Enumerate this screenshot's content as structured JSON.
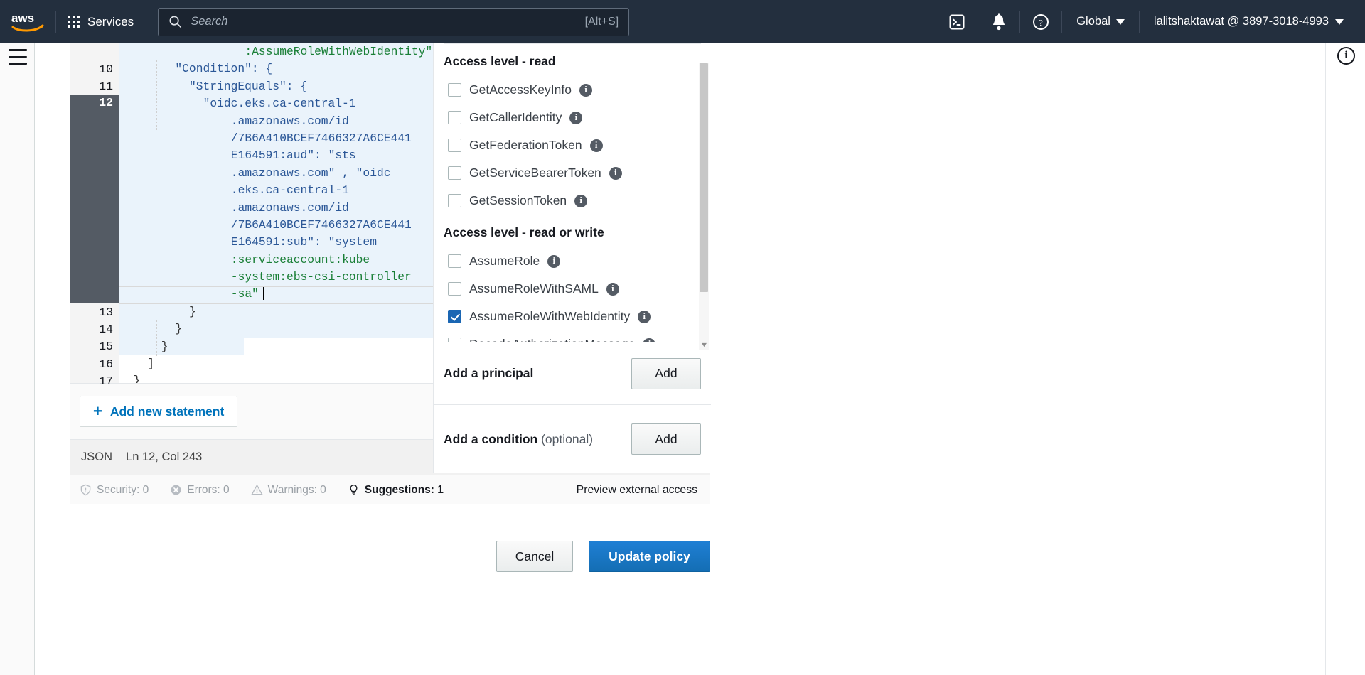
{
  "nav": {
    "logo_alt": "aws",
    "services_label": "Services",
    "search_placeholder": "Search",
    "search_shortcut": "[Alt+S]",
    "cloudshell_icon": "cloudshell-icon",
    "notifications_icon": "bell-icon",
    "help_icon": "help-icon",
    "region_label": "Global",
    "account_label": "lalitshaktawat @ 3897-3018-4993"
  },
  "editor": {
    "language": "JSON",
    "position": "Ln 12, Col 243",
    "add_statement_label": "Add new statement",
    "add_statement_icon": "plus-icon",
    "lines": [
      {
        "num": "",
        "indent": 0,
        "text": ":AssumeRoleWithWebIdentity\",",
        "pad": 18,
        "kind": "str",
        "highlight": true
      },
      {
        "num": "10",
        "fold": true,
        "indent": 0,
        "text": "\"Condition\": {",
        "pad": 8,
        "kind": "key",
        "highlight": true
      },
      {
        "num": "11",
        "fold": true,
        "indent": 0,
        "text": "\"StringEquals\": {",
        "pad": 10,
        "kind": "key",
        "highlight": true
      },
      {
        "num": "12",
        "fold": false,
        "indent": 0,
        "text": "\"oidc.eks.ca-central-1",
        "pad": 12,
        "kind": "key",
        "highlight": true,
        "active": true
      },
      {
        "num": "",
        "indent": 0,
        "text": ".amazonaws.com/id",
        "pad": 16,
        "kind": "key",
        "highlight": true
      },
      {
        "num": "",
        "indent": 0,
        "text": "/7B6A410BCEF7466327A6CE441",
        "pad": 16,
        "kind": "key",
        "highlight": true
      },
      {
        "num": "",
        "indent": 0,
        "text": "E164591:aud\": \"sts",
        "pad": 16,
        "kind": "mixed",
        "highlight": true
      },
      {
        "num": "",
        "indent": 0,
        "text": ".amazonaws.com\" , \"oidc",
        "pad": 16,
        "kind": "mixed",
        "highlight": true
      },
      {
        "num": "",
        "indent": 0,
        "text": ".eks.ca-central-1",
        "pad": 16,
        "kind": "key",
        "highlight": true
      },
      {
        "num": "",
        "indent": 0,
        "text": ".amazonaws.com/id",
        "pad": 16,
        "kind": "key",
        "highlight": true
      },
      {
        "num": "",
        "indent": 0,
        "text": "/7B6A410BCEF7466327A6CE441",
        "pad": 16,
        "kind": "key",
        "highlight": true
      },
      {
        "num": "",
        "indent": 0,
        "text": "E164591:sub\": \"system",
        "pad": 16,
        "kind": "mixed",
        "highlight": true
      },
      {
        "num": "",
        "indent": 0,
        "text": ":serviceaccount:kube",
        "pad": 16,
        "kind": "str",
        "highlight": true
      },
      {
        "num": "",
        "indent": 0,
        "text": "-system:ebs-csi-controller",
        "pad": 16,
        "kind": "str",
        "highlight": true
      },
      {
        "num": "",
        "indent": 0,
        "text": "-sa\"",
        "pad": 16,
        "kind": "str",
        "highlight": true,
        "cursor": true
      },
      {
        "num": "13",
        "indent": 0,
        "text": "}",
        "pad": 10,
        "kind": "punct",
        "highlight": true
      },
      {
        "num": "14",
        "indent": 0,
        "text": "}",
        "pad": 8,
        "kind": "punct",
        "highlight": true
      },
      {
        "num": "15",
        "indent": 0,
        "text": "}",
        "pad": 6,
        "kind": "punct",
        "highlight": "partial"
      },
      {
        "num": "16",
        "indent": 0,
        "text": "]",
        "pad": 4,
        "kind": "punct",
        "highlight": false
      },
      {
        "num": "17",
        "indent": 0,
        "text": "}",
        "pad": 2,
        "kind": "punct",
        "highlight": false
      }
    ]
  },
  "footer": {
    "security_label": "Security: 0",
    "security_icon": "shield-icon",
    "errors_label": "Errors: 0",
    "errors_icon": "error-circle-icon",
    "warnings_label": "Warnings: 0",
    "warnings_icon": "warning-triangle-icon",
    "suggestions_label": "Suggestions: 1",
    "suggestions_icon": "lightbulb-icon",
    "preview_label": "Preview external access"
  },
  "permissions": {
    "sections": [
      {
        "heading": "Access level - read",
        "items": [
          {
            "label": "GetAccessKeyInfo",
            "checked": false,
            "info": "i"
          },
          {
            "label": "GetCallerIdentity",
            "checked": false,
            "info": "i"
          },
          {
            "label": "GetFederationToken",
            "checked": false,
            "info": "i"
          },
          {
            "label": "GetServiceBearerToken",
            "checked": false,
            "info": "i"
          },
          {
            "label": "GetSessionToken",
            "checked": false,
            "info": "i"
          }
        ]
      },
      {
        "heading": "Access level - read or write",
        "items": [
          {
            "label": "AssumeRole",
            "checked": false,
            "info": "i"
          },
          {
            "label": "AssumeRoleWithSAML",
            "checked": false,
            "info": "i"
          },
          {
            "label": "AssumeRoleWithWebIdentity",
            "checked": true,
            "info": "i"
          },
          {
            "label": "DecodeAuthorizationMessage",
            "checked": false,
            "info": "i"
          }
        ]
      }
    ],
    "add_principal": {
      "label": "Add a principal",
      "optional": "",
      "button": "Add"
    },
    "add_condition": {
      "label": "Add a condition",
      "optional": " (optional)",
      "button": "Add"
    }
  },
  "actions": {
    "cancel_label": "Cancel",
    "update_label": "Update policy"
  },
  "colors": {
    "nav_bg": "#232f3e",
    "link_blue": "#0073bb",
    "primary_blue": "#146eb4",
    "checkbox_blue": "#1a66b3",
    "code_key": "#2b5797",
    "code_string": "#1a7f37",
    "gutter_active": "#545b64",
    "highlight": "#eaf3fb"
  }
}
